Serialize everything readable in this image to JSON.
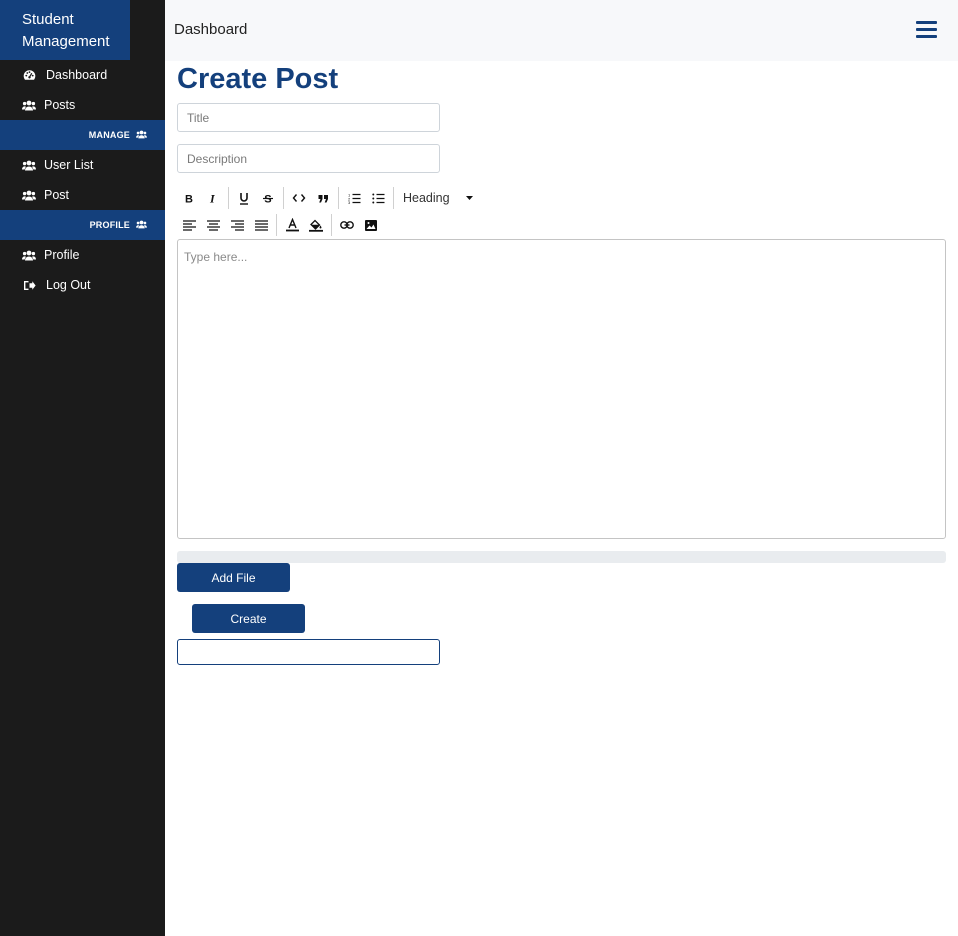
{
  "sidebar": {
    "brand": "Student Management",
    "items": [
      {
        "label": "Dashboard",
        "icon": "tachometer-icon"
      },
      {
        "label": "Posts",
        "icon": "users-icon"
      }
    ],
    "sections": [
      {
        "label": "MANAGE",
        "icon": "users-icon",
        "items": [
          {
            "label": "User List",
            "icon": "users-icon"
          },
          {
            "label": "Post",
            "icon": "users-icon"
          }
        ]
      },
      {
        "label": "PROFILE",
        "icon": "users-icon",
        "items": [
          {
            "label": "Profile",
            "icon": "users-icon"
          },
          {
            "label": "Log Out",
            "icon": "sign-out-icon"
          }
        ]
      }
    ]
  },
  "topbar": {
    "title": "Dashboard",
    "menu_icon": "hamburger-icon"
  },
  "main": {
    "title": "Create Post",
    "title_input": {
      "value": "",
      "placeholder": "Title"
    },
    "description_input": {
      "value": "",
      "placeholder": "Description"
    },
    "toolbar": {
      "row1": [
        "bold-icon",
        "italic-icon",
        "underline-icon",
        "strikethrough-icon",
        "code-icon",
        "blockquote-icon",
        "ordered-list-icon",
        "unordered-list-icon"
      ],
      "heading_label": "Heading",
      "row2": [
        "align-left-icon",
        "align-center-icon",
        "align-right-icon",
        "align-justify-icon",
        "font-color-icon",
        "highlight-color-icon",
        "link-icon",
        "image-icon"
      ]
    },
    "editor": {
      "placeholder": "Type here..."
    },
    "upload_progress": 0,
    "add_file_label": "Add File",
    "create_label": "Create"
  },
  "colors": {
    "primary": "#14407c",
    "sidebar_bg": "#1b1b1b",
    "topbar_bg": "#f7f8fa",
    "progress_bg": "#e9ecef"
  }
}
